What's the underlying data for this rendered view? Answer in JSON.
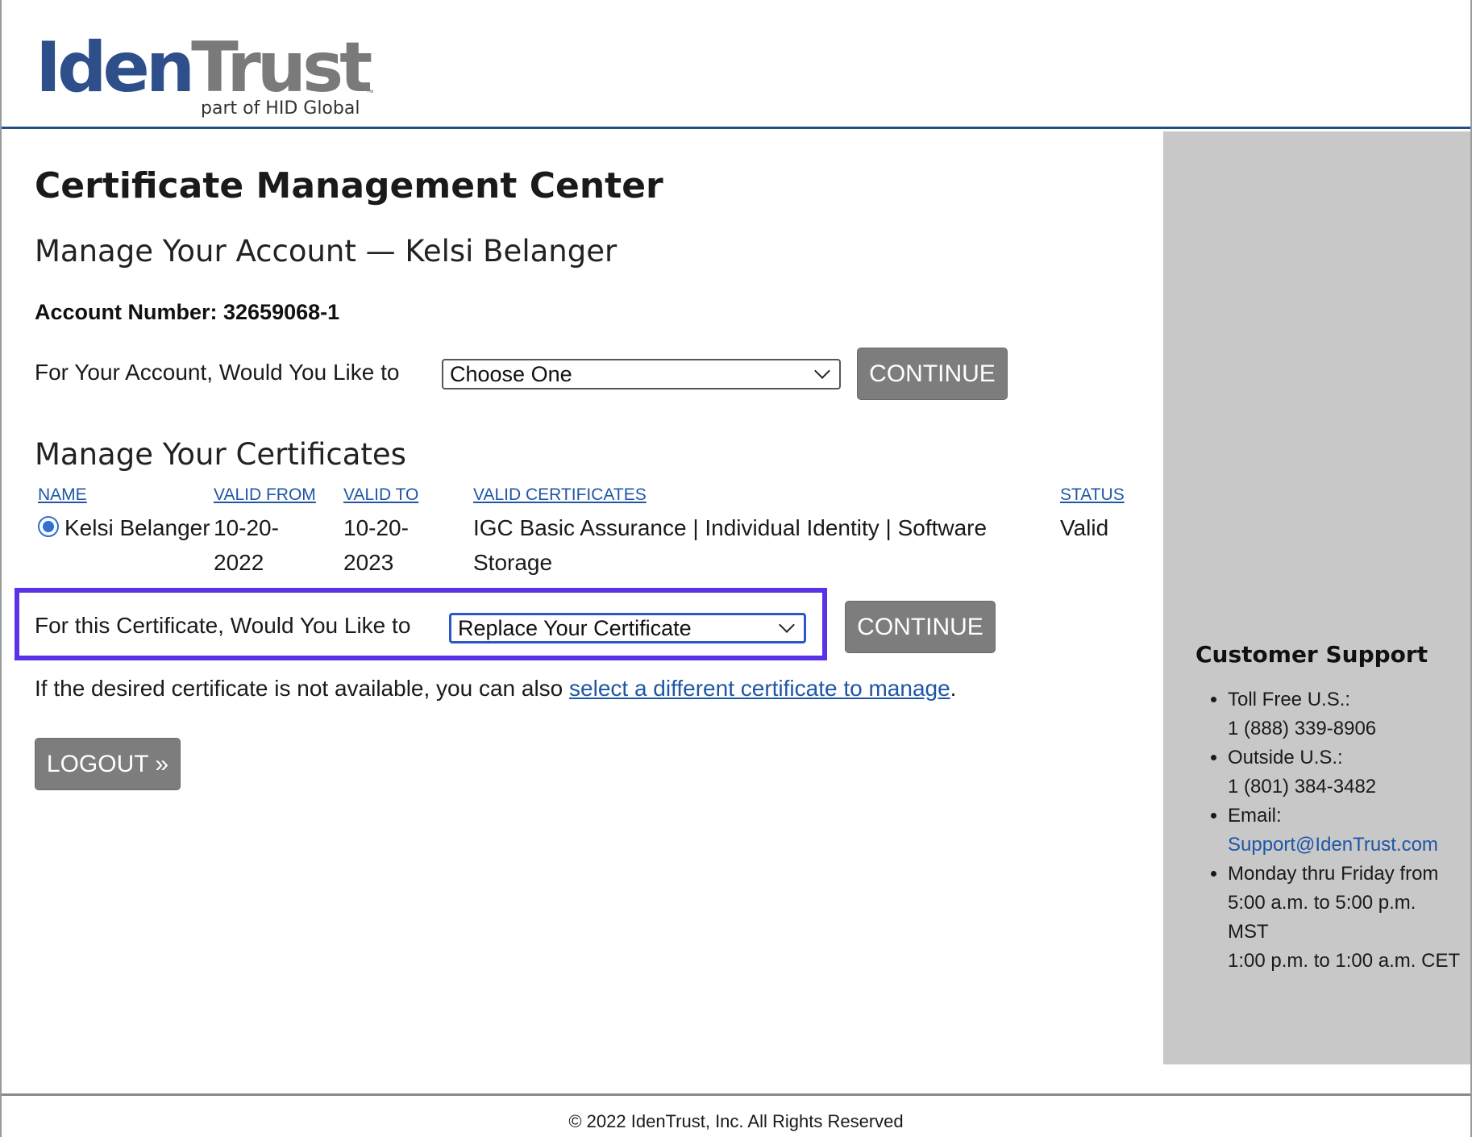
{
  "logo": {
    "word_iden": "Iden",
    "word_trust": "Trust",
    "tm": "™",
    "tagline": "part of HID Global"
  },
  "page": {
    "title": "Certificate Management Center",
    "subtitle": "Manage Your Account — Kelsi Belanger",
    "account_number": "Account Number: 32659068-1"
  },
  "account_actions": {
    "label": "For Your Account, Would You Like to",
    "select_value": "Choose One",
    "continue_label": "CONTINUE"
  },
  "certificates": {
    "title": "Manage Your Certificates",
    "columns": [
      "NAME",
      "VALID FROM",
      "VALID TO",
      "VALID CERTIFICATES",
      "STATUS"
    ],
    "rows": [
      {
        "selected": true,
        "name": "Kelsi Belanger",
        "valid_from": "10-20-2022",
        "valid_to": "10-20-2023",
        "certificate": "IGC Basic Assurance | Individual Identity | Software Storage",
        "status": "Valid"
      }
    ]
  },
  "certificate_actions": {
    "label": "For this Certificate, Would You Like to",
    "select_value": "Replace Your Certificate",
    "continue_label": "CONTINUE",
    "highlight_color": "#5b32e6"
  },
  "note": {
    "prefix": "If the desired certificate is not available, you can also ",
    "link": "select a different certificate to manage",
    "suffix": "."
  },
  "logout_label": "LOGOUT »",
  "support": {
    "title": "Customer Support",
    "items": [
      {
        "label": "Toll Free U.S.:",
        "value": "1 (888) 339-8906"
      },
      {
        "label": "Outside U.S.:",
        "value": "1 (801) 384-3482"
      },
      {
        "label": "Email:",
        "value": "Support@IdenTrust.com"
      },
      {
        "label": "Monday thru Friday from",
        "value": "5:00 a.m. to 5:00 p.m. MST",
        "value2": "1:00 p.m. to 1:00 a.m. CET"
      }
    ]
  },
  "footer": "© 2022 IdenTrust, Inc. All Rights Reserved",
  "colors": {
    "brand_blue": "#2e4f8a",
    "link_blue": "#1f56a6",
    "button_gray": "#7d7d7d",
    "sidebar_gray": "#c8c8c8"
  }
}
